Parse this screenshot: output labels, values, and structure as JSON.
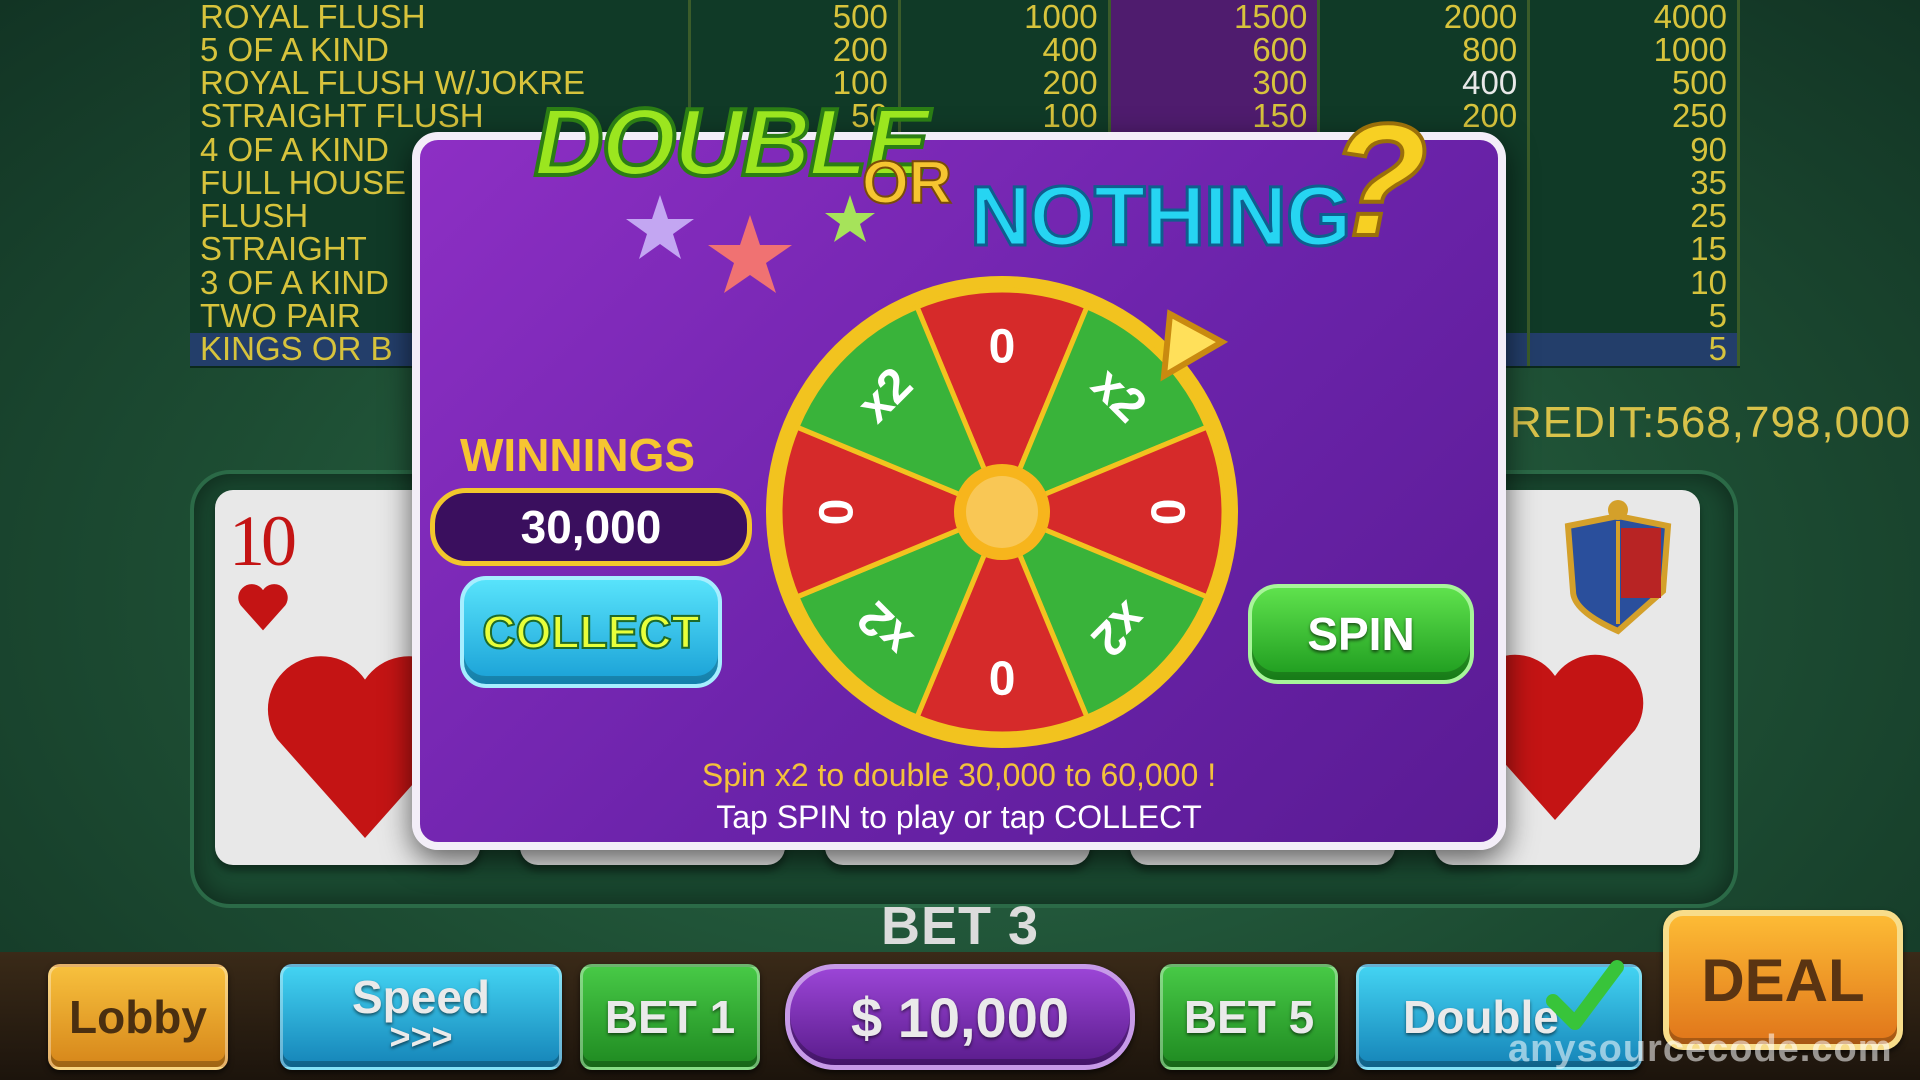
{
  "paytable": {
    "rows": [
      {
        "name": "ROYAL FLUSH",
        "values": [
          "500",
          "1000",
          "1500",
          "2000",
          "4000"
        ]
      },
      {
        "name": "5 OF A KIND",
        "values": [
          "200",
          "400",
          "600",
          "800",
          "1000"
        ]
      },
      {
        "name": "ROYAL FLUSH W/JOKRE",
        "values": [
          "100",
          "200",
          "300",
          "400",
          "500"
        ]
      },
      {
        "name": "STRAIGHT FLUSH",
        "values": [
          "50",
          "100",
          "150",
          "200",
          "250"
        ]
      },
      {
        "name": "4 OF A KIND",
        "values": [
          "",
          "",
          "",
          "",
          "90"
        ]
      },
      {
        "name": "FULL HOUSE",
        "values": [
          "",
          "",
          "",
          "",
          "35"
        ]
      },
      {
        "name": "FLUSH",
        "values": [
          "",
          "",
          "",
          "",
          "25"
        ]
      },
      {
        "name": "STRAIGHT",
        "values": [
          "",
          "",
          "",
          "",
          "15"
        ]
      },
      {
        "name": "3 OF A KIND",
        "values": [
          "",
          "",
          "",
          "",
          "10"
        ]
      },
      {
        "name": "TWO PAIR",
        "values": [
          "",
          "",
          "",
          "",
          "5"
        ]
      },
      {
        "name": "KINGS OR B",
        "values": [
          "",
          "",
          "",
          "",
          "5"
        ]
      }
    ],
    "highlight_column_index": 2,
    "highlight_row_index": 10,
    "colors": {
      "text": "#d7c33c",
      "highlight_column": "#4f1c6e",
      "highlight_row": "#233e6a"
    }
  },
  "credit": "REDIT:568,798,000",
  "cards": {
    "left": {
      "rank": "10",
      "suit": "heart"
    },
    "right": {
      "suit": "heart",
      "emblem": "crest-icon"
    }
  },
  "bet_label": "BET 3",
  "bottom_bar": {
    "lobby": "Lobby",
    "speed": "Speed",
    "speed_arrows": ">>>",
    "bet1": "BET 1",
    "amount": "$ 10,000",
    "bet5": "BET 5",
    "double": "Double",
    "deal": "DEAL"
  },
  "watermark": "anysourcecode.com",
  "modal": {
    "title_double": "DOUBLE",
    "title_or": "OR",
    "title_nothing": "NOTHING",
    "title_question": "?",
    "winnings_label": "WINNINGS",
    "winnings_value": "30,000",
    "collect": "COLLECT",
    "spin": "SPIN",
    "line1": "Spin x2 to double 30,000 to 60,000 !",
    "line2": "Tap SPIN to play or tap COLLECT",
    "wheel": {
      "segments": [
        "0",
        "x2",
        "0",
        "x2",
        "0",
        "x2",
        "0",
        "x2"
      ],
      "colors": {
        "zero": "#d62a2a",
        "x2": "#39b33a",
        "rim": "#f2c31f",
        "hub": "#f7b51c"
      }
    }
  }
}
